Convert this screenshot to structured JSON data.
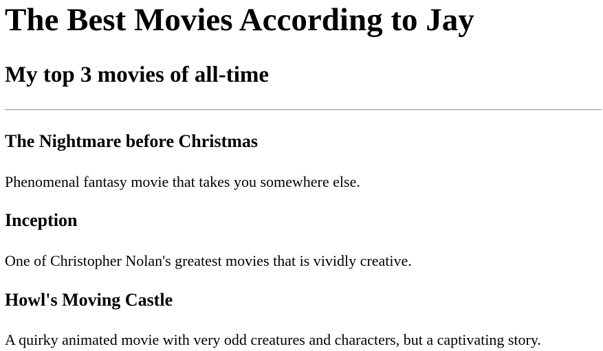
{
  "page": {
    "title": "The Best Movies According to Jay",
    "subtitle": "My top 3 movies of all-time"
  },
  "movies": [
    {
      "title": "The Nightmare before Christmas",
      "description": "Phenomenal fantasy movie that takes you somewhere else."
    },
    {
      "title": "Inception",
      "description": "One of Christopher Nolan's greatest movies that is vividly creative."
    },
    {
      "title": "Howl's Moving Castle",
      "description": "A quirky animated movie with very odd creatures and characters, but a captivating story."
    }
  ]
}
